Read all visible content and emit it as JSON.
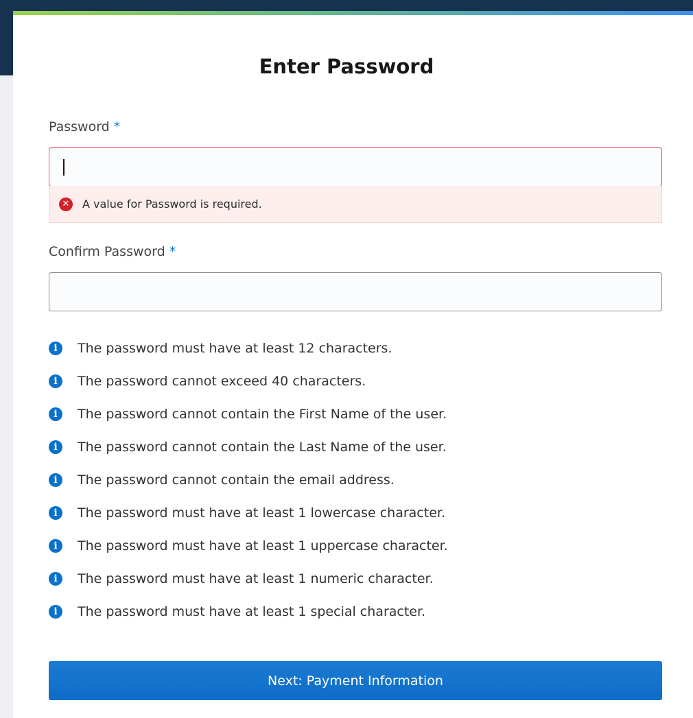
{
  "page": {
    "title": "Enter Password"
  },
  "password": {
    "label": "Password",
    "required_mark": "*",
    "value": "",
    "error": "A value for Password is required."
  },
  "confirm_password": {
    "label": "Confirm Password",
    "required_mark": "*",
    "value": ""
  },
  "rules": [
    "The password must have at least 12 characters.",
    "The password cannot exceed 40 characters.",
    "The password cannot contain the First Name of the user.",
    "The password cannot contain the Last Name of the user.",
    "The password cannot contain the email address.",
    "The password must have at least 1 lowercase character.",
    "The password must have at least 1 uppercase character.",
    "The password must have at least 1 numeric character.",
    "The password must have at least 1 special character."
  ],
  "icons": {
    "error": "error-x-icon",
    "info": "info-icon"
  },
  "colors": {
    "accent": "#0b72c9",
    "error": "#d4222b",
    "error_bg": "#fdeeee",
    "header_dark": "#16324f"
  },
  "actions": {
    "next_label": "Next: Payment Information"
  }
}
